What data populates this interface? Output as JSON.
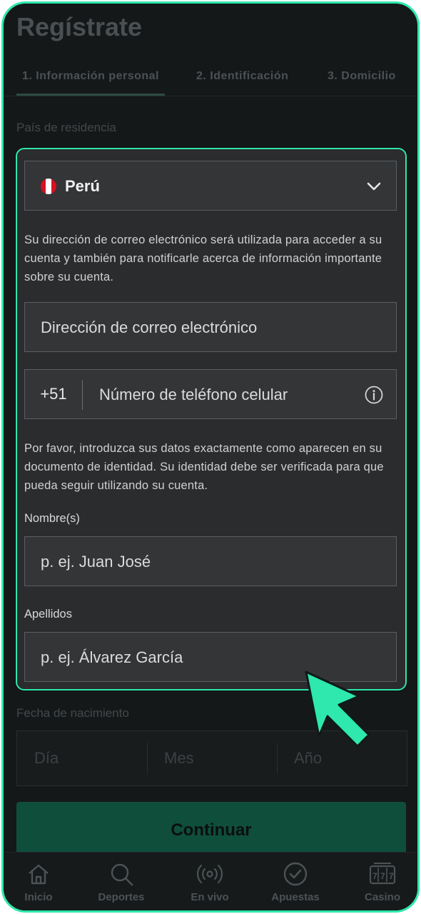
{
  "page": {
    "title": "Regístrate",
    "tabs": [
      {
        "label": "1. Información personal"
      },
      {
        "label": "2. Identificación"
      },
      {
        "label": "3. Domicilio"
      }
    ],
    "country_label": "País de residencia",
    "dob_label": "Fecha de nacimiento",
    "dob_fields": {
      "day": "Día",
      "month": "Mes",
      "year": "Año"
    },
    "continue_label": "Continuar"
  },
  "form": {
    "country": {
      "value": "Perú",
      "flag": "peru-flag"
    },
    "email_note": "Su dirección de correo electrónico será utilizada para acceder a su cuenta y también para notificarle acerca de información importante sobre su cuenta.",
    "email_placeholder": "Dirección de correo electrónico",
    "phone_prefix": "+51",
    "phone_placeholder": "Número de teléfono celular",
    "identity_note": "Por favor, introduzca sus datos exactamente como aparecen en su documento de identidad. Su identidad debe ser verificada para que pueda seguir utilizando su cuenta.",
    "first_name_label": "Nombre(s)",
    "first_name_placeholder": "p. ej. Juan José",
    "last_name_label": "Apellidos",
    "last_name_placeholder": "p. ej. Álvarez García"
  },
  "bottom_nav": [
    {
      "label": "Inicio",
      "icon": "home-icon"
    },
    {
      "label": "Deportes",
      "icon": "search-icon"
    },
    {
      "label": "En vivo",
      "icon": "live-icon"
    },
    {
      "label": "Apuestas",
      "icon": "check-circle-icon"
    },
    {
      "label": "Casino",
      "icon": "slot-machine-icon"
    }
  ],
  "colors": {
    "accent": "#2ee8ad",
    "background": "#151819",
    "card": "#2a2c2e"
  }
}
